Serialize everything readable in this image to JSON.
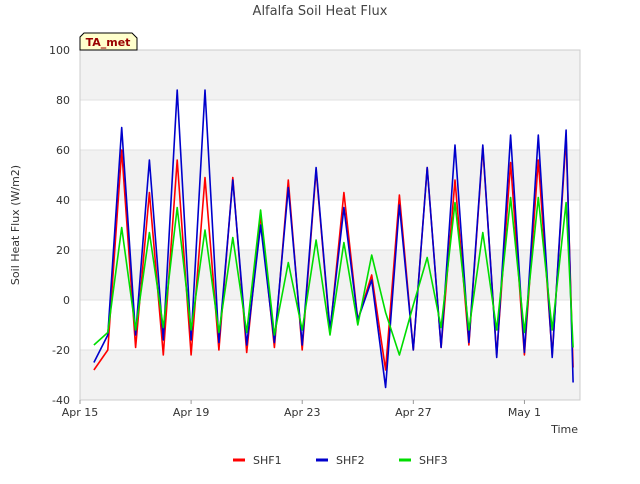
{
  "chart_data": {
    "type": "line",
    "title": "Alfalfa Soil Heat Flux",
    "xlabel": "Time",
    "ylabel": "Soil Heat Flux (W/m2)",
    "ylim": [
      -40,
      100
    ],
    "yticks": [
      -40,
      -20,
      0,
      20,
      40,
      60,
      80,
      100
    ],
    "xlim": [
      "2024-04-15",
      "2024-05-03"
    ],
    "xticks": [
      {
        "date": "2024-04-15",
        "label": "Apr 15"
      },
      {
        "date": "2024-04-19",
        "label": "Apr 19"
      },
      {
        "date": "2024-04-23",
        "label": "Apr 23"
      },
      {
        "date": "2024-04-27",
        "label": "Apr 27"
      },
      {
        "date": "2024-05-01",
        "label": "May 1"
      }
    ],
    "grid": "horizontal bands",
    "badge": "TA_met",
    "legend_position": "bottom",
    "x": [
      "2024-04-15 12:00",
      "2024-04-16 00:00",
      "2024-04-16 12:00",
      "2024-04-17 00:00",
      "2024-04-17 12:00",
      "2024-04-18 00:00",
      "2024-04-18 12:00",
      "2024-04-19 00:00",
      "2024-04-19 12:00",
      "2024-04-20 00:00",
      "2024-04-20 12:00",
      "2024-04-21 00:00",
      "2024-04-21 12:00",
      "2024-04-22 00:00",
      "2024-04-22 12:00",
      "2024-04-23 00:00",
      "2024-04-23 12:00",
      "2024-04-24 00:00",
      "2024-04-24 12:00",
      "2024-04-25 00:00",
      "2024-04-25 12:00",
      "2024-04-26 00:00",
      "2024-04-26 12:00",
      "2024-04-27 00:00",
      "2024-04-27 12:00",
      "2024-04-28 00:00",
      "2024-04-28 12:00",
      "2024-04-29 00:00",
      "2024-04-29 12:00",
      "2024-04-30 00:00",
      "2024-04-30 12:00",
      "2024-05-01 00:00",
      "2024-05-01 12:00",
      "2024-05-02 00:00",
      "2024-05-02 12:00",
      "2024-05-02 18:00"
    ],
    "series": [
      {
        "name": "SHF1",
        "color": "#ff0000",
        "values": [
          -28,
          -20,
          60,
          -19,
          43,
          -22,
          56,
          -22,
          49,
          -20,
          49,
          -21,
          34,
          -19,
          48,
          -20,
          52,
          -13,
          43,
          -8,
          10,
          -28,
          42,
          -20,
          53,
          -19,
          48,
          -18,
          61,
          -22,
          55,
          -22,
          56,
          -22,
          65,
          -27
        ]
      },
      {
        "name": "SHF2",
        "color": "#0000cc",
        "values": [
          -25,
          -14,
          69,
          -14,
          56,
          -16,
          84,
          -16,
          84,
          -17,
          48,
          -18,
          30,
          -17,
          45,
          -18,
          53,
          -12,
          37,
          -8,
          8,
          -35,
          38,
          -20,
          53,
          -19,
          62,
          -17,
          62,
          -23,
          66,
          -21,
          66,
          -23,
          68,
          -33
        ]
      },
      {
        "name": "SHF3",
        "color": "#00dd00",
        "values": [
          -18,
          -13,
          29,
          -12,
          27,
          -11,
          37,
          -12,
          28,
          -13,
          25,
          -13,
          36,
          -14,
          15,
          -12,
          24,
          -14,
          23,
          -10,
          18,
          -5,
          -22,
          -2,
          17,
          -11,
          39,
          -12,
          27,
          -12,
          41,
          -13,
          41,
          -12,
          39,
          -19
        ]
      }
    ]
  }
}
